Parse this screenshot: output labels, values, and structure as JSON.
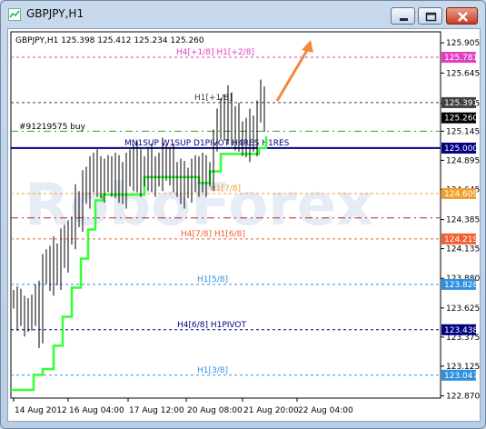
{
  "window": {
    "title": "GBPJPY,H1"
  },
  "chart_data": {
    "type": "candlestick",
    "symbol_info": "GBPJPY,H1  125.398 125.412 125.234 125.260",
    "trade_label": "#91219575 buy",
    "watermark": "RoboForex",
    "ylim": [
      122.85,
      126.0
    ],
    "y_ticks": [
      "125.905",
      "125.645",
      "125.385",
      "125.145",
      "124.895",
      "124.645",
      "124.385",
      "124.135",
      "123.880",
      "123.625",
      "123.375",
      "123.125",
      "122.870"
    ],
    "x_ticks": [
      "14 Aug 2012",
      "16 Aug 04:00",
      "17 Aug 12:00",
      "20 Aug 08:00",
      "21 Aug 20:00",
      "22 Aug 04:00"
    ],
    "levels": [
      {
        "value": 125.781,
        "price_label": "125.781",
        "text": "H4[+1/8] H1[+2/8]",
        "color": "#e040c0",
        "dash": "3,3",
        "badge": "#e040c0"
      },
      {
        "value": 125.391,
        "price_label": "125.391",
        "text": "H1[+1/8]",
        "color": "#404040",
        "dash": "3,3",
        "badge": "#404040"
      },
      {
        "value": 125.26,
        "price_label": "125.260",
        "text": "",
        "color": "",
        "dash": "",
        "badge": "#000000"
      },
      {
        "value": 125.145,
        "price_label": "",
        "text": "",
        "color": "#22aa22",
        "dash": "8,4,2,4",
        "badge": ""
      },
      {
        "value": 125.0,
        "price_label": "125.000",
        "text": "MN1SUP W1SUP D1PIVOT H4RES H1RES",
        "color": "#000080",
        "dash": "",
        "badge": "#000080"
      },
      {
        "value": 124.609,
        "price_label": "124.609",
        "text": "H1[7/8]",
        "color": "#f0a030",
        "dash": "3,3",
        "badge": "#f0a030"
      },
      {
        "value": 124.4,
        "price_label": "",
        "text": "",
        "color": "#c02020",
        "dash": "8,4,2,4",
        "badge": ""
      },
      {
        "value": 124.219,
        "price_label": "124.219",
        "text": "H4[7/8] H1[6/8]",
        "color": "#f06030",
        "dash": "3,3",
        "badge": "#f06030"
      },
      {
        "value": 123.828,
        "price_label": "123.828",
        "text": "H1[5/8]",
        "color": "#3090e0",
        "dash": "3,3",
        "badge": "#3090e0"
      },
      {
        "value": 123.438,
        "price_label": "123.438",
        "text": "H4[6/8] H1PIVOT",
        "color": "#000080",
        "dash": "3,3",
        "badge": "#000080"
      },
      {
        "value": 123.047,
        "price_label": "123.047",
        "text": "H1[3/8]",
        "color": "#3090e0",
        "dash": "3,3",
        "badge": "#3090e0"
      }
    ],
    "colors": {
      "candles": "#000000",
      "stop_line": "#33ff33",
      "arrow": "#f28a3c",
      "grid_text": "#000000"
    }
  }
}
